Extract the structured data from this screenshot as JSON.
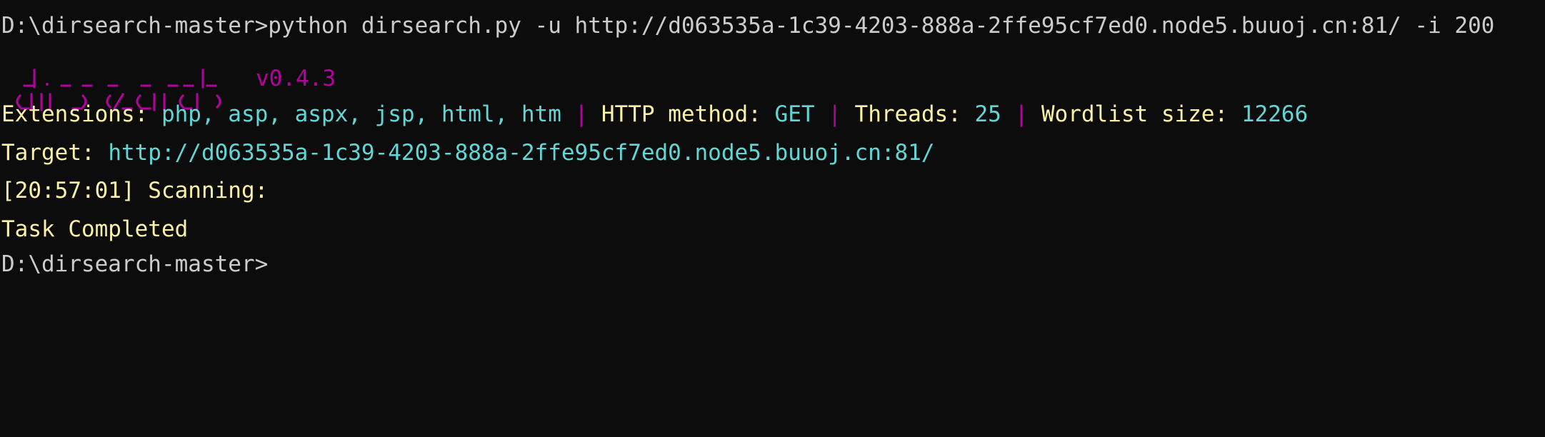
{
  "colors": {
    "background": "#0c0c0c",
    "foreground": "#cccccc",
    "yellow": "#f9f1a5",
    "cyan": "#61d6d6",
    "magenta": "#b4009e"
  },
  "command_line": {
    "prompt": "D:\\dirsearch-master>",
    "command": "python dirsearch.py -u http://d063535a-1c39-4203-888a-2ffe95cf7ed0.node5.buuoj.cn:81/ -i 200"
  },
  "banner": {
    "logo_text": "dirsearch",
    "version": "v0.4.3"
  },
  "config": {
    "extensions_label": "Extensions: ",
    "extensions_value": "php, asp, aspx, jsp, html, htm",
    "separator": " | ",
    "http_method_label": "HTTP method: ",
    "http_method_value": "GET",
    "threads_label": "Threads: ",
    "threads_value": "25",
    "wordlist_label": "Wordlist size: ",
    "wordlist_value": "12266"
  },
  "target": {
    "label": "Target: ",
    "url": "http://d063535a-1c39-4203-888a-2ffe95cf7ed0.node5.buuoj.cn:81/"
  },
  "scan": {
    "status": "[20:57:01] Scanning:"
  },
  "result": {
    "status": "Task Completed"
  },
  "final_prompt": {
    "text": "D:\\dirsearch-master>"
  }
}
